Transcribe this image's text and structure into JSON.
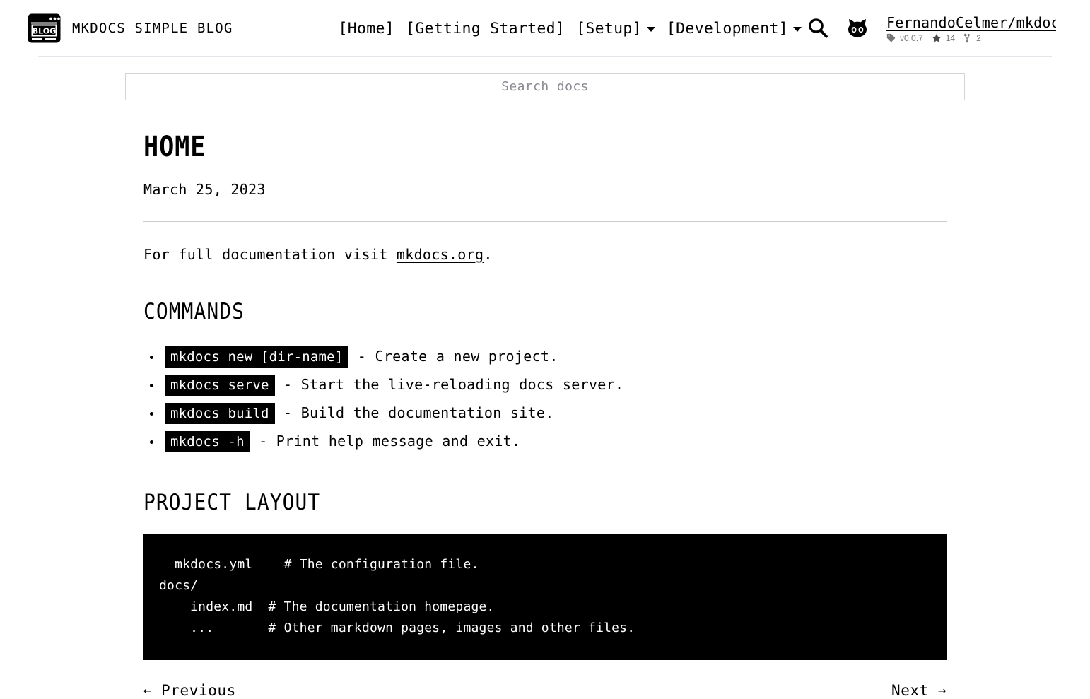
{
  "header": {
    "brand": {
      "logo_icon": "blog-window-icon",
      "logo_text": "BLOG",
      "title": "MKDOCS SIMPLE BLOG"
    },
    "nav": [
      {
        "label": "[Home]",
        "has_dropdown": false
      },
      {
        "label": "[Getting Started]",
        "has_dropdown": false
      },
      {
        "label": "[Setup]",
        "has_dropdown": true
      },
      {
        "label": "[Development]",
        "has_dropdown": true
      }
    ],
    "search_icon": "search-icon",
    "github_icon": "github-octocat-icon",
    "repo": {
      "name": "FernandoCelmer/mkdoc",
      "stats": [
        {
          "icon": "tag-icon",
          "value": "v0.0.7"
        },
        {
          "icon": "star-icon",
          "value": "14"
        },
        {
          "icon": "fork-icon",
          "value": "2"
        }
      ]
    }
  },
  "search": {
    "placeholder": "Search docs",
    "value": ""
  },
  "article": {
    "title": "HOME",
    "date": "March 25, 2023",
    "intro_before": "For full documentation visit ",
    "intro_link": "mkdocs.org",
    "intro_after": ".",
    "commands": {
      "heading": "COMMANDS",
      "items": [
        {
          "code": "mkdocs new [dir-name]",
          "desc": " - Create a new project."
        },
        {
          "code": "mkdocs serve",
          "desc": " - Start the live-reloading docs server."
        },
        {
          "code": "mkdocs build",
          "desc": " - Build the documentation site."
        },
        {
          "code": "mkdocs -h",
          "desc": " - Print help message and exit."
        }
      ]
    },
    "project_layout": {
      "heading": "PROJECT LAYOUT",
      "code": "  mkdocs.yml    # The configuration file.\ndocs/\n    index.md  # The documentation homepage.\n    ...       # Other markdown pages, images and other files."
    }
  },
  "pager": {
    "previous_label": "Previous",
    "previous_arrow": "←",
    "next_label": "Next",
    "next_arrow": "→"
  },
  "colors": {
    "text": "#000000",
    "background": "#ffffff",
    "muted": "#767676",
    "border": "#d3d3d8",
    "code_bg": "#000000",
    "code_fg": "#ffffff"
  }
}
